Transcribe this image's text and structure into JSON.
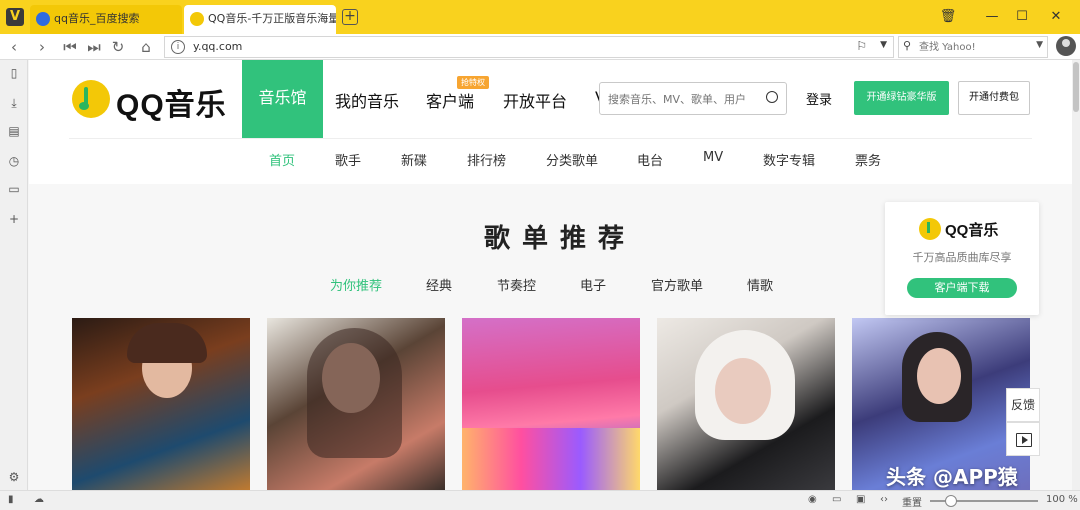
{
  "browser": {
    "app_logo": "V",
    "tabs": [
      {
        "label": "qq音乐_百度搜索",
        "active": false
      },
      {
        "label": "QQ音乐-千万正版音乐海量",
        "active": true
      }
    ],
    "new_tab_label": "+",
    "url": "y.qq.com",
    "search_placeholder": "查找 Yahoo!",
    "window_buttons": [
      "🗑",
      "—",
      "☐",
      "✕"
    ]
  },
  "site": {
    "brand": "QQ音乐",
    "nav": [
      {
        "label": "音乐馆",
        "active": true
      },
      {
        "label": "我的音乐"
      },
      {
        "label": "客户端",
        "badge": "抢特权"
      },
      {
        "label": "开放平台"
      },
      {
        "label": "V"
      }
    ],
    "search_placeholder": "搜索音乐、MV、歌单、用户",
    "login_label": "登录",
    "btn_vip": "开通绿钻豪华版",
    "btn_paid": "开通付费包",
    "subnav": [
      "首页",
      "歌手",
      "新碟",
      "排行榜",
      "分类歌单",
      "电台",
      "MV",
      "数字专辑",
      "票务"
    ],
    "subnav_active": "首页",
    "section_title": "歌单推荐",
    "categories": [
      "为你推荐",
      "经典",
      "节奏控",
      "电子",
      "官方歌单",
      "情歌"
    ],
    "categories_active": "为你推荐"
  },
  "promo": {
    "name": "QQ音乐",
    "tagline": "千万高品质曲库尽享",
    "download_label": "客户端下载"
  },
  "floating": {
    "feedback_label": "反馈"
  },
  "statusbar": {
    "reset_label": "重置",
    "zoom": "100 %"
  },
  "watermark": "头条 @APP猿",
  "colors": {
    "accent": "#31c27c",
    "browser_chrome": "#f9d21e"
  }
}
